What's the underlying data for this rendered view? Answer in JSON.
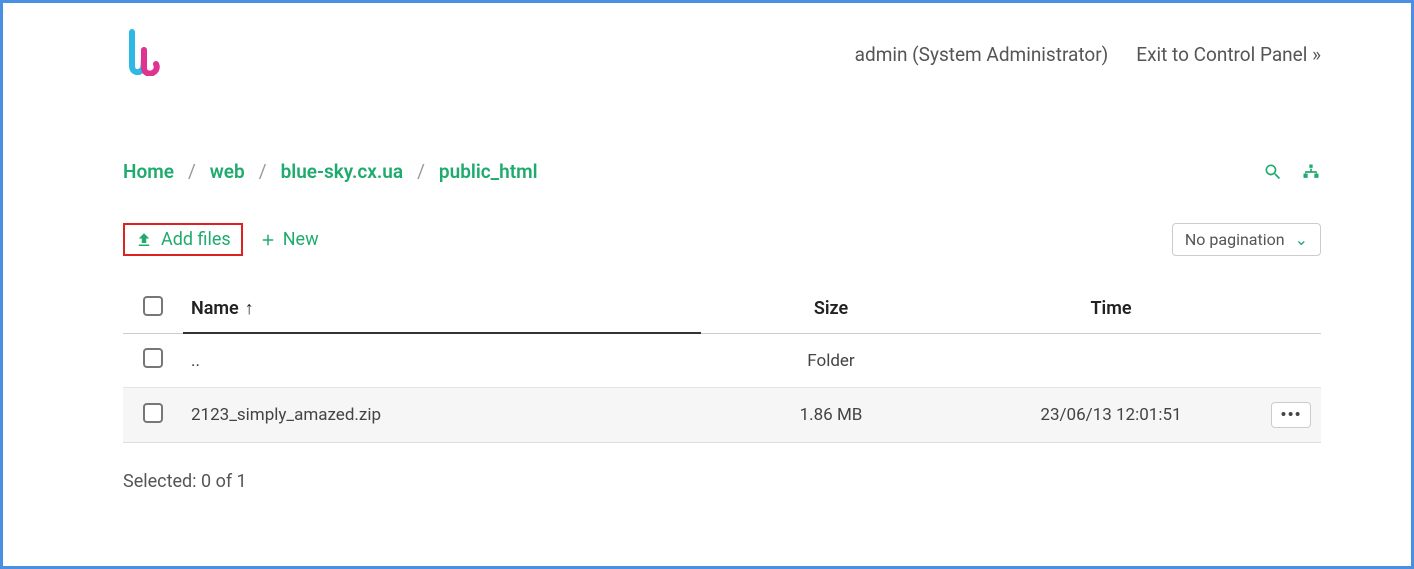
{
  "header": {
    "user_label": "admin (System Administrator)",
    "exit_label": "Exit to Control Panel »"
  },
  "breadcrumb": {
    "items": [
      "Home",
      "web",
      "blue-sky.cx.ua",
      "public_html"
    ]
  },
  "actions": {
    "add_files_label": "Add files",
    "new_label": "New",
    "pagination_label": "No pagination"
  },
  "table": {
    "headers": {
      "name": "Name",
      "size": "Size",
      "time": "Time"
    },
    "rows": [
      {
        "name": "..",
        "size": "Folder",
        "time": "",
        "is_file": false
      },
      {
        "name": "2123_simply_amazed.zip",
        "size": "1.86 MB",
        "time": "23/06/13 12:01:51",
        "is_file": true
      }
    ]
  },
  "status": {
    "selected_label": "Selected: 0 of 1"
  }
}
